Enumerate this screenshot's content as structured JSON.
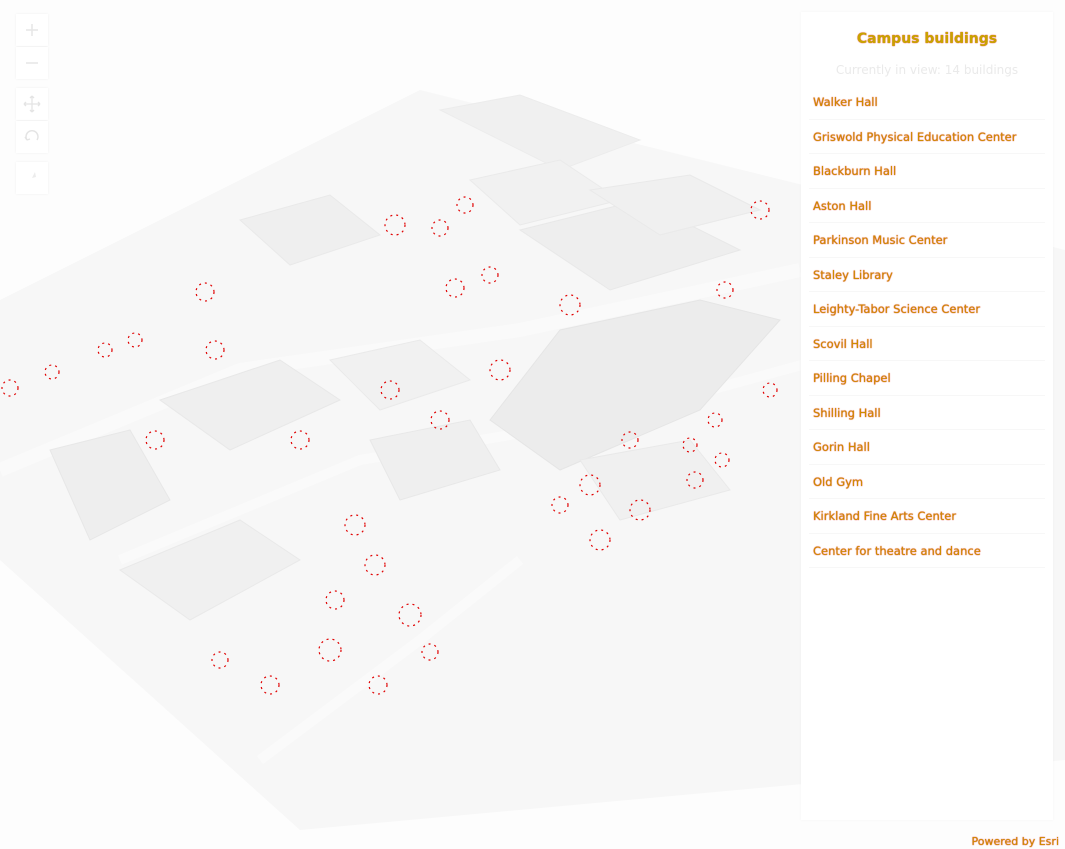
{
  "panel": {
    "title": "Campus buildings",
    "count_text": "Currently in view: 14 buildings",
    "buildings": [
      "Walker Hall",
      "Griswold Physical Education Center",
      "Blackburn Hall",
      "Aston Hall",
      "Parkinson Music Center",
      "Staley Library",
      "Leighty-Tabor Science Center",
      "Scovil Hall",
      "Pilling Chapel",
      "Shilling Hall",
      "Gorin Hall",
      "Old Gym",
      "Kirkland Fine Arts Center",
      "Center for theatre and dance"
    ]
  },
  "map_controls": {
    "zoom_in_icon": "plus-icon",
    "zoom_out_icon": "minus-icon",
    "pan_icon": "move-icon",
    "rotate_icon": "rotate-icon",
    "compass_icon": "compass-icon"
  },
  "attribution": "Powered by Esri",
  "colors": {
    "link_text": "#cc8f00",
    "edge_highlight": "#e00000",
    "building_fill": "#f2f2f2"
  }
}
